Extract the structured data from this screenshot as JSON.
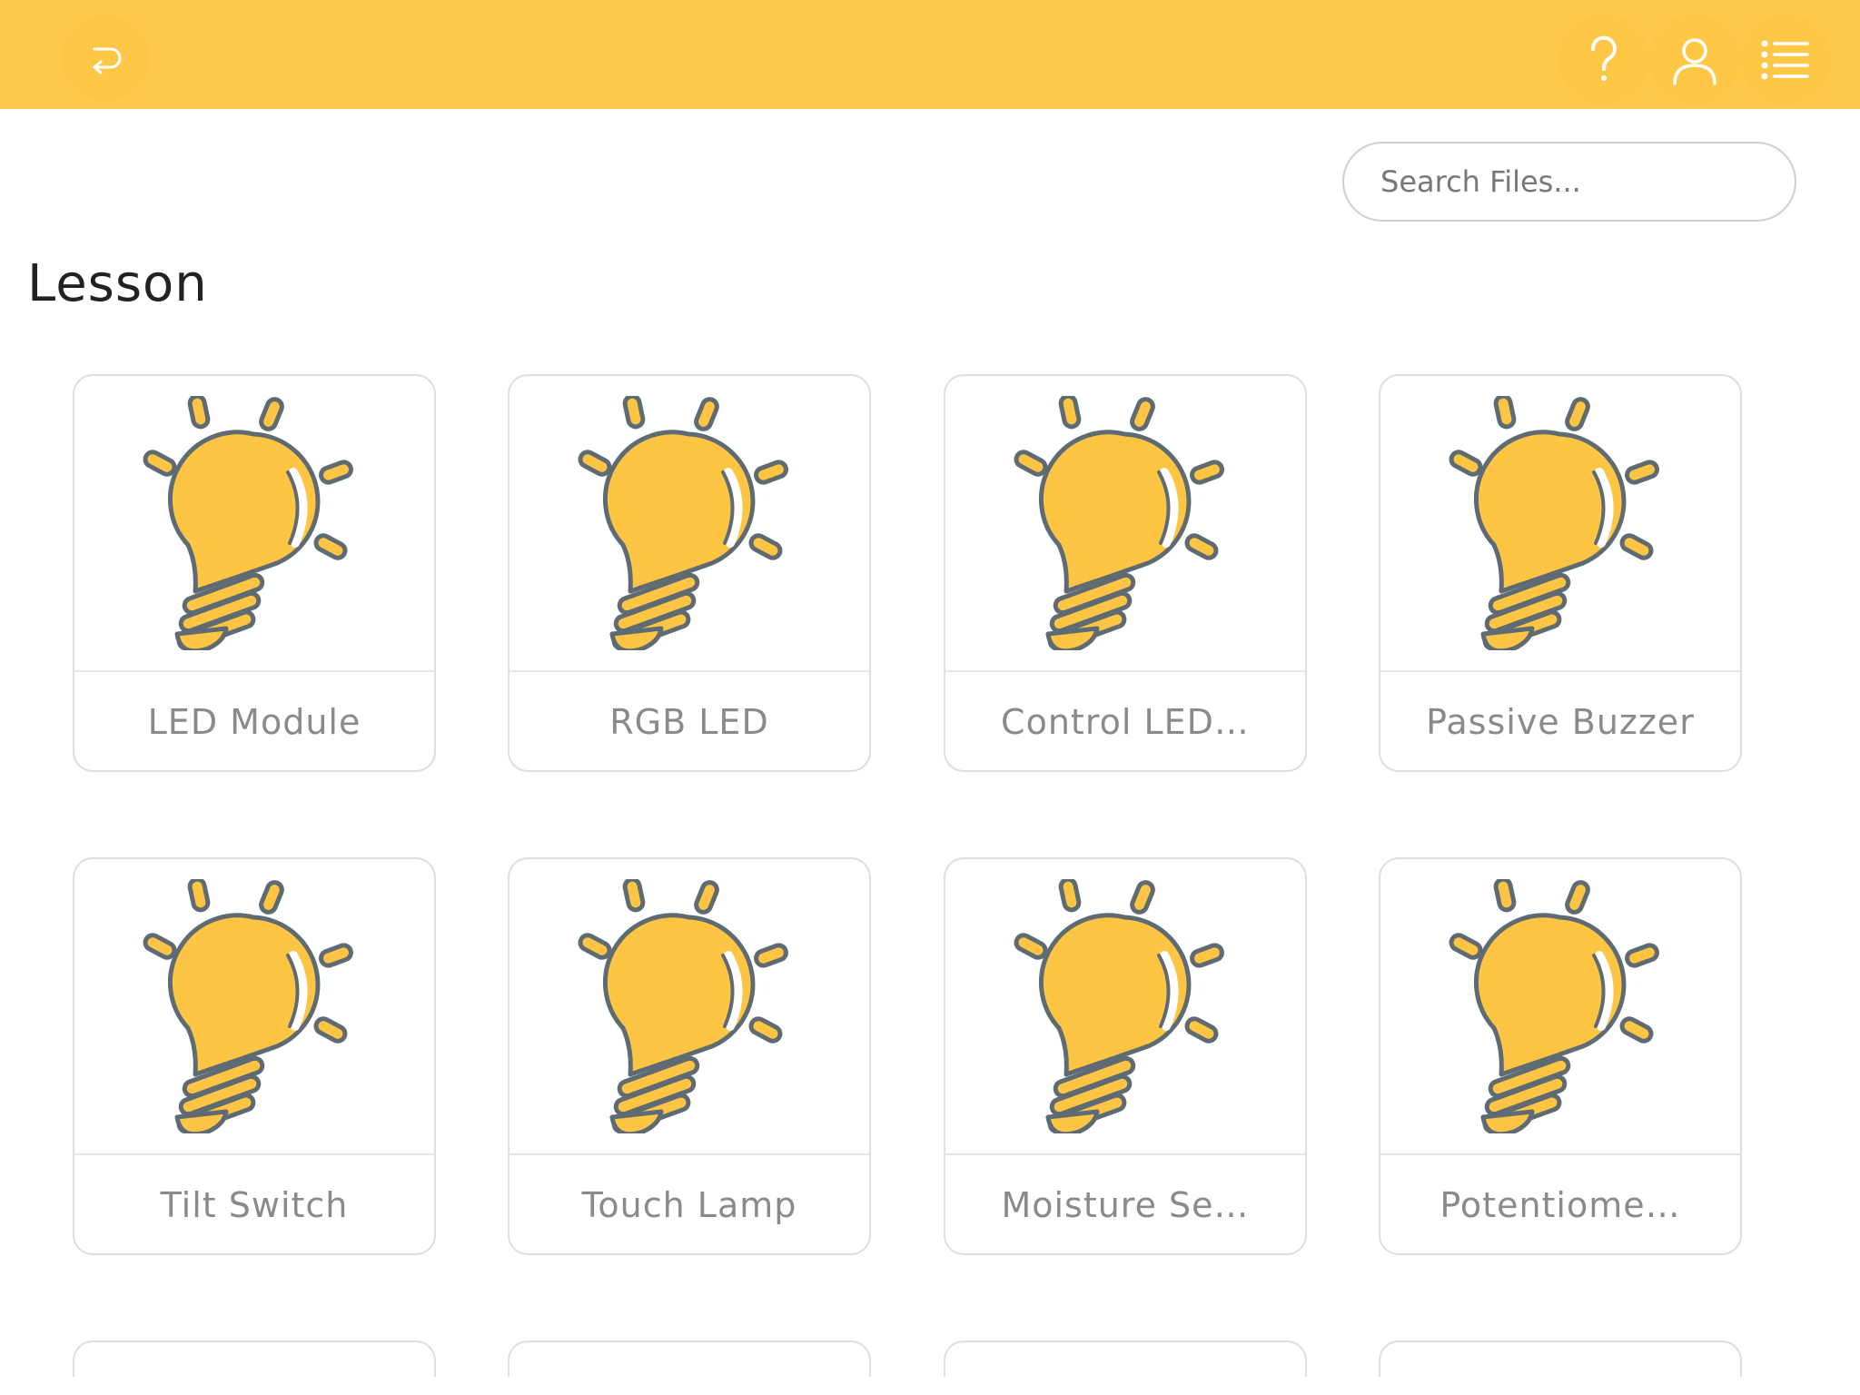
{
  "header": {
    "back_icon": "back-arrow-icon",
    "help_icon": "question-mark-icon",
    "user_icon": "user-icon",
    "menu_icon": "list-menu-icon",
    "background": "#ffc94b"
  },
  "search": {
    "placeholder": "Search Files..."
  },
  "section": {
    "title": "Lesson"
  },
  "cards": [
    {
      "label": "LED Module",
      "icon": "lightbulb-icon"
    },
    {
      "label": "RGB LED",
      "icon": "lightbulb-icon"
    },
    {
      "label": "Control LED…",
      "icon": "lightbulb-icon"
    },
    {
      "label": "Passive Buzzer",
      "icon": "lightbulb-icon"
    },
    {
      "label": "Tilt Switch",
      "icon": "lightbulb-icon"
    },
    {
      "label": "Touch Lamp",
      "icon": "lightbulb-icon"
    },
    {
      "label": "Moisture Se…",
      "icon": "lightbulb-icon"
    },
    {
      "label": "Potentiome…",
      "icon": "lightbulb-icon"
    }
  ],
  "colors": {
    "accent": "#ffc94b",
    "bulb": "#fec545",
    "outline": "#5f6b73"
  }
}
